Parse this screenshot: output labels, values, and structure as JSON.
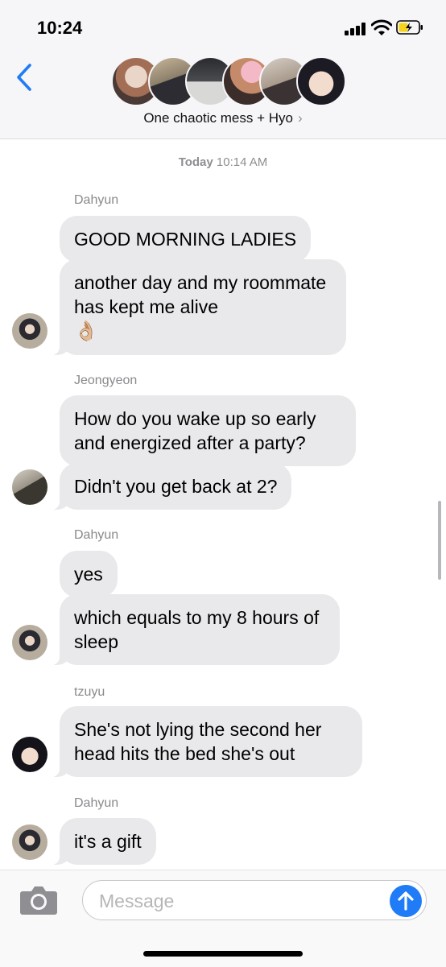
{
  "status": {
    "time": "10:24"
  },
  "header": {
    "title": "One chaotic mess + Hyo",
    "chevron": "›"
  },
  "timestamp": {
    "day": "Today",
    "time": "10:14 AM"
  },
  "messages": [
    {
      "sender": "Dahyun",
      "bubbles": [
        "GOOD MORNING LADIES",
        "another day and my roommate has kept me alive"
      ]
    },
    {
      "sender": "Jeongyeon",
      "bubbles": [
        "How do you wake up so early and energized after a party?",
        "Didn't you get back at 2?"
      ]
    },
    {
      "sender": "Dahyun",
      "bubbles": [
        "yes",
        "which equals to my 8 hours of sleep"
      ]
    },
    {
      "sender": "tzuyu",
      "bubbles": [
        "She's not lying the second her head hits the bed she's out"
      ]
    },
    {
      "sender": "Dahyun",
      "bubbles": [
        "it's a gift"
      ]
    }
  ],
  "emoji": "👌🏼",
  "composer": {
    "placeholder": "Message"
  },
  "icons": [
    "back-chevron-icon",
    "camera-icon",
    "send-arrow-icon",
    "signal-icon",
    "wifi-icon",
    "battery-icon"
  ],
  "colors": {
    "accent": "#1f7cf6",
    "bubble": "#e9e9eb",
    "header_bg": "#f6f6f8"
  }
}
